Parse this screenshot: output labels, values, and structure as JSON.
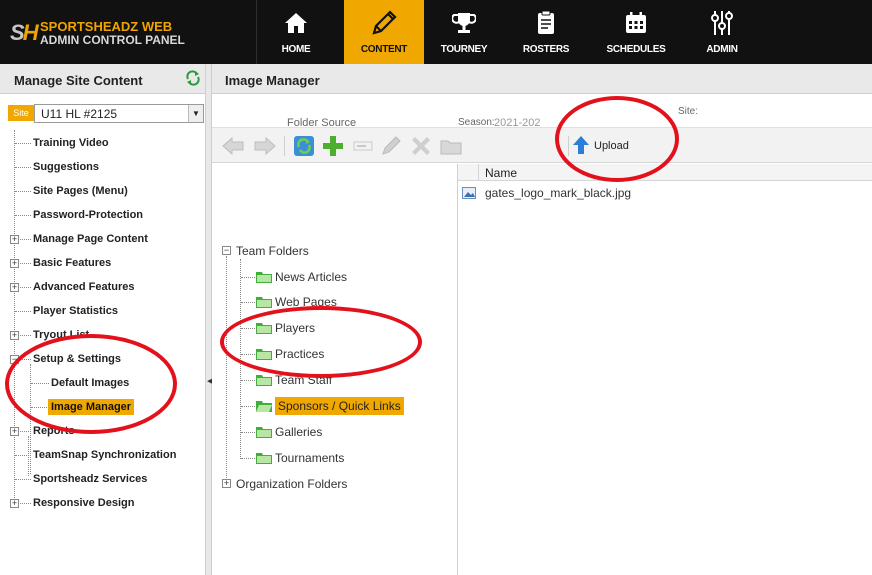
{
  "brand": {
    "logo_text": "SH",
    "line1": "SPORTSHEADZ WEB",
    "line2": "ADMIN CONTROL PANEL"
  },
  "nav": {
    "tabs": [
      {
        "label": "HOME",
        "icon": "home-icon"
      },
      {
        "label": "CONTENT",
        "icon": "pencil-icon",
        "active": true
      },
      {
        "label": "TOURNEY",
        "icon": "trophy-icon"
      },
      {
        "label": "ROSTERS",
        "icon": "clipboard-icon"
      },
      {
        "label": "SCHEDULES",
        "icon": "calendar-icon"
      },
      {
        "label": "ADMIN",
        "icon": "sliders-icon"
      }
    ]
  },
  "left": {
    "title": "Manage Site Content",
    "site_label": "Site",
    "site_value": "U11 HL #2125",
    "items": [
      {
        "label": "Training Video"
      },
      {
        "label": "Suggestions"
      },
      {
        "label": "Site Pages (Menu)"
      },
      {
        "label": "Password-Protection"
      },
      {
        "label": "Manage Page Content",
        "expandable": true
      },
      {
        "label": "Basic Features",
        "expandable": true
      },
      {
        "label": "Advanced Features",
        "expandable": true
      },
      {
        "label": "Player Statistics"
      },
      {
        "label": "Tryout List",
        "expandable": true
      },
      {
        "label": "Setup & Settings",
        "expanded": true
      },
      {
        "label": "Default Images",
        "child": true
      },
      {
        "label": "Image Manager",
        "child": true,
        "selected": true
      },
      {
        "label": "Reports",
        "expandable": true
      },
      {
        "label": "TeamSnap Synchronization"
      },
      {
        "label": "Sportsheadz Services"
      },
      {
        "label": "Responsive Design",
        "expandable": true
      }
    ]
  },
  "main": {
    "title": "Image Manager",
    "folder_source_label": "Folder Source",
    "season_label": "Season:",
    "season_value": "2021-202",
    "site_label": "Site:",
    "upload_label": "Upload",
    "folders": {
      "root1": "Team Folders",
      "children": [
        "News Articles",
        "Web Pages",
        "Players",
        "Practices",
        "Team Staff",
        "Sponsors / Quick Links",
        "Galleries",
        "Tournaments"
      ],
      "selected_index": 5,
      "root2": "Organization Folders"
    },
    "files": {
      "name_header": "Name",
      "rows": [
        "gates_logo_mark_black.jpg"
      ]
    }
  },
  "colors": {
    "accent": "#f0a800",
    "topbar": "#111111",
    "annotation": "#e3111b"
  }
}
